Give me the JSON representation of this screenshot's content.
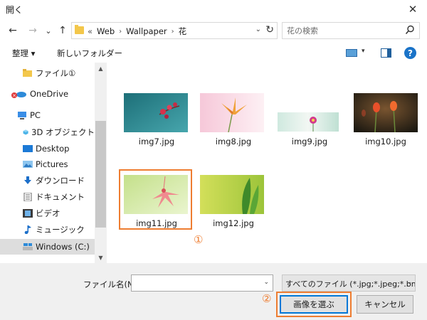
{
  "window": {
    "title": "開く",
    "close_glyph": "✕"
  },
  "nav": {
    "back_glyph": "←",
    "forward_glyph": "→",
    "recent_glyph": "⌄",
    "up_glyph": "↑",
    "breadcrumb_overflow": "«",
    "breadcrumbs": [
      "Web",
      "Wallpaper",
      "花"
    ],
    "crumb_sep": "›",
    "address_dropdown_glyph": "⌄",
    "refresh_glyph": "↻",
    "search_placeholder": "花の検索"
  },
  "toolbar": {
    "organize_label": "整理 ▾",
    "new_folder_label": "新しいフォルダー",
    "view_dropdown_glyph": "▾",
    "help_glyph": "?"
  },
  "sidebar": {
    "items": [
      {
        "label": "ファイル①",
        "icon": "folder-icon"
      },
      {
        "label": "OneDrive",
        "icon": "onedrive-icon"
      },
      {
        "label": "PC",
        "icon": "pc-icon"
      },
      {
        "label": "3D オブジェクト",
        "icon": "3d-objects-icon"
      },
      {
        "label": "Desktop",
        "icon": "desktop-icon"
      },
      {
        "label": "Pictures",
        "icon": "pictures-icon"
      },
      {
        "label": "ダウンロード",
        "icon": "download-icon"
      },
      {
        "label": "ドキュメント",
        "icon": "documents-icon"
      },
      {
        "label": "ビデオ",
        "icon": "video-icon"
      },
      {
        "label": "ミュージック",
        "icon": "music-icon"
      },
      {
        "label": "Windows (C:)",
        "icon": "drive-icon"
      }
    ],
    "selected": "Windows (C:)",
    "scroll_up_glyph": "▲",
    "scroll_down_glyph": "▼"
  },
  "files": [
    {
      "name": "img7.jpg"
    },
    {
      "name": "img8.jpg"
    },
    {
      "name": "img9.jpg"
    },
    {
      "name": "img10.jpg"
    },
    {
      "name": "img11.jpg"
    },
    {
      "name": "img12.jpg"
    }
  ],
  "annotations": {
    "step1": "①",
    "step2": "②",
    "color": "#ee7d31"
  },
  "footer": {
    "filename_label": "ファイル名(N):",
    "filename_value": "",
    "filename_dropdown_glyph": "⌄",
    "filetype_value": "すべてのファイル (*.jpg;*.jpeg;*.bmp",
    "filetype_dropdown_glyph": "⌄",
    "open_button": "画像を選ぶ",
    "cancel_button": "キャンセル"
  },
  "colors": {
    "accent": "#0078d7",
    "selection": "#dddddd",
    "chrome": "#f0f0f0"
  }
}
